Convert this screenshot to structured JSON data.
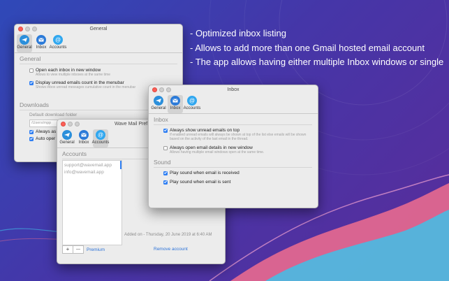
{
  "colors": {
    "accent": "#2f7ff3",
    "bg_start": "#2f49b8",
    "bg_end": "#5a2c9a",
    "wave_pink": "#e86a8f",
    "wave_cyan": "#3fc0e8"
  },
  "bullets": [
    "- Optimized inbox listing",
    "- Allows to add more than one Gmail hosted email account",
    "- The app allows having either multiple Inbox windows or single"
  ],
  "toolbar": {
    "general": "General",
    "inbox": "Inbox",
    "accounts": "Accounts"
  },
  "general_window": {
    "title": "General",
    "section_general": "General",
    "opt1_label": "Open each inbox in new window",
    "opt1_hint": "Allows to view multiple inboxes at the same time",
    "opt1_checked": false,
    "opt2_label": "Display unread emails count in the menubar",
    "opt2_hint": "Shows inbox unread messages cumulative count in the menubar",
    "opt2_checked": true,
    "section_downloads": "Downloads",
    "default_folder_label": "Default download folder",
    "folder_path": "/Users/mpp",
    "opt3_label": "Always as",
    "opt4_label": "Auto oper"
  },
  "accounts_window": {
    "title": "Wave Mail Pref",
    "section": "Accounts",
    "accounts": [
      "support@wavemail.app",
      "info@wavemail.app"
    ],
    "added_on": "Added on - Thursday, 20 June 2019 at 6:40 AM",
    "remove": "Remove account",
    "add_btn": "+",
    "remove_btn": "—",
    "premium": "Premium"
  },
  "inbox_window": {
    "title": "Inbox",
    "section_inbox": "Inbox",
    "opt1_label": "Always show unread emails on top",
    "opt1_hint": "If enabled unread emails will always be shown at top of the list else emails will be shown based on the activity of the last email in the thread.",
    "opt1_checked": true,
    "opt2_label": "Always open email details in new window",
    "opt2_hint": "Allows having multiple email windows open at the same time.",
    "opt2_checked": false,
    "section_sound": "Sound",
    "opt3_label": "Play sound when email is received",
    "opt3_checked": true,
    "opt4_label": "Play sound when email is sent",
    "opt4_checked": true
  }
}
